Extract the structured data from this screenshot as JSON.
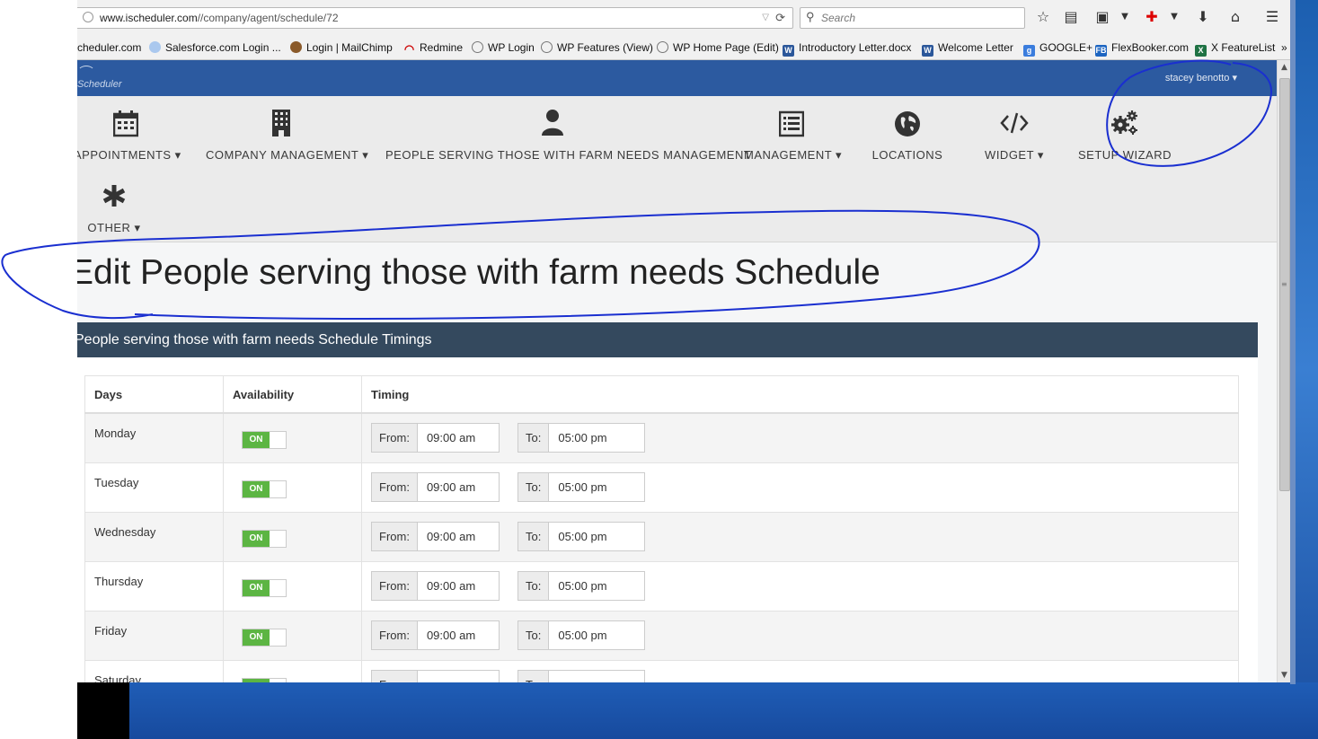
{
  "browser": {
    "url_domain": "www.ischeduler.com",
    "url_path": "//company/agent/schedule/72",
    "search_placeholder": "Search",
    "bookmarks": [
      "cheduler.com",
      "Salesforce.com Login ...",
      "Login | MailChimp",
      "Redmine",
      "WP Login",
      "WP Features (View)",
      "WP Home Page (Edit)",
      "Introductory Letter.docx",
      "Welcome Letter",
      "GOOGLE+",
      "FlexBooker.com",
      "X FeatureList"
    ],
    "bookmarks_overflow": "»"
  },
  "app": {
    "logo_text": "Scheduler",
    "user_name": "stacey benotto ▾",
    "menu": [
      {
        "label": "APPOINTMENTS ▾",
        "icon": "calendar-icon"
      },
      {
        "label": "COMPANY MANAGEMENT ▾",
        "icon": "building-icon"
      },
      {
        "label": "PEOPLE SERVING THOSE WITH FARM NEEDS MANAGEMENT",
        "icon": "user-icon"
      },
      {
        "label": "MANAGEMENT ▾",
        "icon": "list-icon"
      },
      {
        "label": "LOCATIONS",
        "icon": "globe-icon"
      },
      {
        "label": "WIDGET ▾",
        "icon": "code-icon"
      },
      {
        "label": "SETUP WIZARD",
        "icon": "gears-icon"
      },
      {
        "label": "OTHER ▾",
        "icon": "asterisk-icon"
      }
    ]
  },
  "page": {
    "title": "Edit People serving those with farm needs Schedule",
    "panel_title": "People serving those with farm needs Schedule Timings",
    "columns": [
      "Days",
      "Availability",
      "Timing"
    ],
    "from_label": "From:",
    "to_label": "To:",
    "toggle_label": "ON",
    "rows": [
      {
        "day": "Monday",
        "from": "09:00 am",
        "to": "05:00 pm"
      },
      {
        "day": "Tuesday",
        "from": "09:00 am",
        "to": "05:00 pm"
      },
      {
        "day": "Wednesday",
        "from": "09:00 am",
        "to": "05:00 pm"
      },
      {
        "day": "Thursday",
        "from": "09:00 am",
        "to": "05:00 pm"
      },
      {
        "day": "Friday",
        "from": "09:00 am",
        "to": "05:00 pm"
      },
      {
        "day": "Saturday",
        "from": "",
        "to": ""
      }
    ]
  },
  "colors": {
    "brand_blue": "#2c5aa0",
    "panel_header": "#34495e",
    "toggle_on": "#5cb543",
    "annotation_ink": "#1a2fd0"
  }
}
